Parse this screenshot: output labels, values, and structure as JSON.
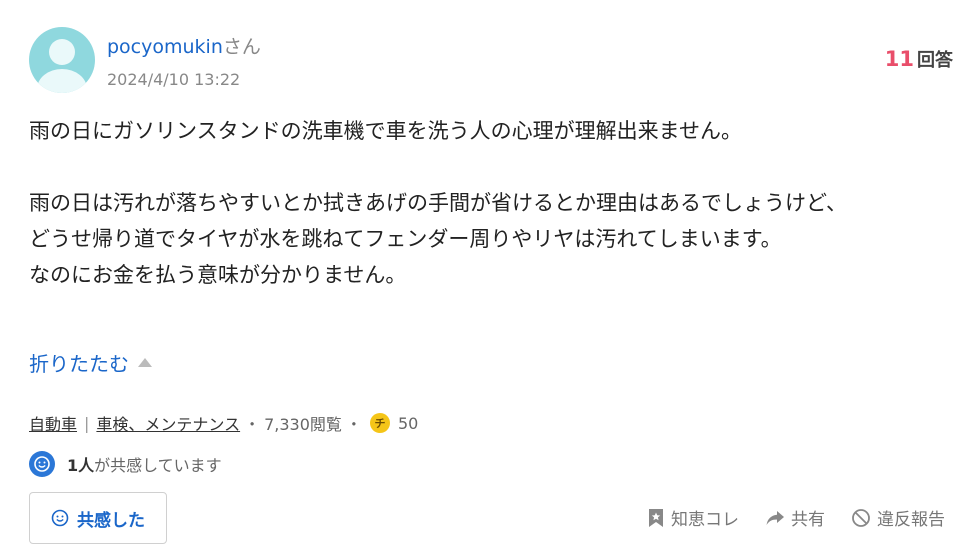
{
  "question": {
    "username": "pocyomukin",
    "honorific": "さん",
    "timestamp": "2024/4/10 13:22",
    "answer_count": "11",
    "answer_label": "回答",
    "paragraphs": [
      "雨の日にガソリンスタンドの洗車機で車を洗う人の心理が理解出来ません。",
      "雨の日は汚れが落ちやすいとか拭きあげの手間が省けるとか理由はあるでしょうけど、",
      "どうせ帰り道でタイヤが水を跳ねてフェンダー周りやリヤは汚れてしまいます。",
      "なのにお金を払う意味が分かりません。"
    ],
    "collapse_label": "折りたたむ"
  },
  "meta": {
    "category1": "自動車",
    "separator": "|",
    "category2": "車検、メンテナンス",
    "dot": "・",
    "views": "7,330閲覧",
    "coin_icon_text": "チ",
    "coins": "50"
  },
  "empathy": {
    "count": "1人",
    "text": "が共感しています",
    "button_label": "共感した"
  },
  "actions": {
    "chiebukuro": "知恵コレ",
    "share": "共有",
    "report": "違反報告"
  },
  "icons": {
    "avatar": "user-avatar-icon",
    "smile": "smile-icon",
    "bookmark": "bookmark-star-icon",
    "share": "share-arrow-icon",
    "report": "prohibit-icon"
  },
  "colors": {
    "link": "#1a66c9",
    "answer_count": "#e94e6a",
    "coin": "#f5c518"
  }
}
